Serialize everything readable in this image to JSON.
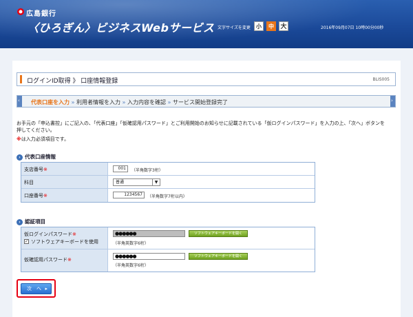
{
  "header": {
    "bank_name": "広島銀行",
    "title": "〈ひろぎん〉ビジネスWebサービス",
    "font_size_label": "文字サイズを変更",
    "font_size_small": "小",
    "font_size_medium": "中",
    "font_size_large": "大",
    "datetime": "2016年09月07日 10時00分00秒",
    "accent_color": "#e8751a"
  },
  "page": {
    "title": "ログインID取得 》 口座情報登録",
    "screen_code": "BLIS005"
  },
  "steps": [
    {
      "label": "代表口座を入力",
      "current": true
    },
    {
      "label": "利用者情報を入力",
      "current": false
    },
    {
      "label": "入力内容を確認",
      "current": false
    },
    {
      "label": "サービス開始登録完了",
      "current": false
    }
  ],
  "instructions": {
    "line1": "お手元の「申込書控」にご記入の、「代表口座」「仮確認用パスワード」とご利用開始のお知らせに記載されている「仮ログインパスワード」を入力の上、「次へ」ボタンを",
    "line2": "押してください。",
    "required_mark": "※",
    "required_note": "は入力必須項目です。"
  },
  "section_account": {
    "heading": "代表口座情報",
    "branch_label": "支店番号",
    "branch_value": "001",
    "branch_hint": "（半角数字3桁）",
    "subject_label": "科目",
    "subject_value": "普通",
    "account_label": "口座番号",
    "account_value": "1234567",
    "account_hint": "（半角数字7桁以内）"
  },
  "section_auth": {
    "heading": "認証項目",
    "temp_login_label": "仮ログインパスワード",
    "software_keyboard_label": "ソフトウェアキーボードを使用",
    "temp_login_value": "●●●●●●",
    "temp_login_hint": "（半角英数字6桁）",
    "temp_confirm_label": "仮確認用パスワード",
    "temp_confirm_value": "●●●●●●",
    "temp_confirm_hint": "（半角英数字6桁）",
    "open_keyboard_label": "ソフトウェアキーボードを開く"
  },
  "actions": {
    "next_label": "次　へ"
  }
}
